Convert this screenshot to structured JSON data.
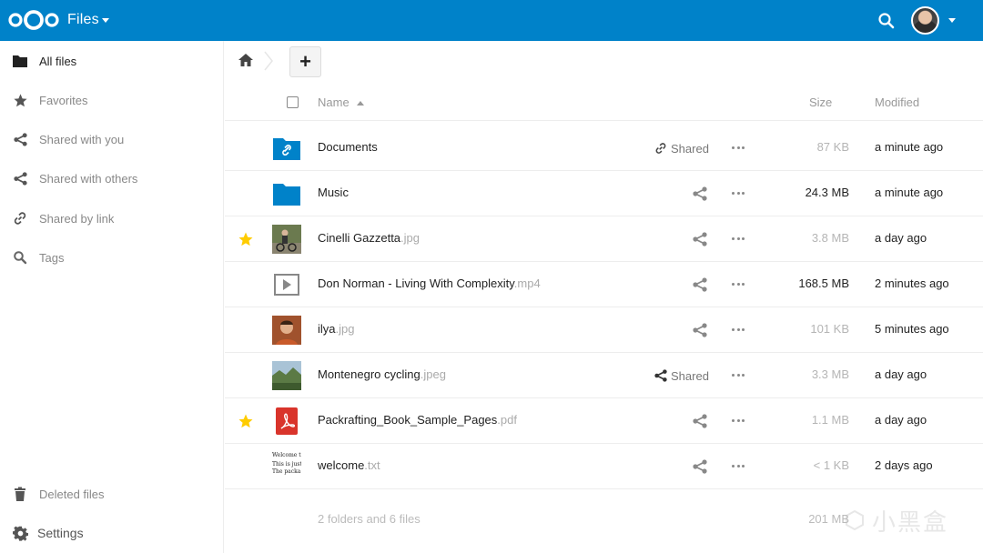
{
  "header": {
    "app_title": "Files",
    "logo_icon": "nextcloud-logo-icon",
    "search_icon": "search-icon",
    "brand_color": "#0082c9"
  },
  "sidebar": {
    "items": [
      {
        "label": "All files",
        "icon": "folder-icon",
        "active": true
      },
      {
        "label": "Favorites",
        "icon": "star-icon"
      },
      {
        "label": "Shared with you",
        "icon": "share-icon"
      },
      {
        "label": "Shared with others",
        "icon": "share-icon"
      },
      {
        "label": "Shared by link",
        "icon": "link-icon"
      },
      {
        "label": "Tags",
        "icon": "tag-search-icon"
      }
    ],
    "bottom": [
      {
        "label": "Deleted files",
        "icon": "trash-icon"
      },
      {
        "label": "Settings",
        "icon": "gear-icon"
      }
    ]
  },
  "breadcrumb": {
    "home_icon": "home-icon",
    "add_label": "+"
  },
  "table": {
    "headers": {
      "name": "Name",
      "size": "Size",
      "modified": "Modified"
    },
    "rows": [
      {
        "name": "Documents",
        "ext": "",
        "type": "folder-link",
        "favorite": false,
        "shared_label": "Shared",
        "share_kind": "link",
        "size": "87 KB",
        "modified": "a minute ago"
      },
      {
        "name": "Music",
        "ext": "",
        "type": "folder",
        "favorite": false,
        "shared_label": "",
        "share_kind": "none",
        "size": "24.3 MB",
        "modified": "a minute ago"
      },
      {
        "name": "Cinelli Gazzetta",
        "ext": ".jpg",
        "type": "image-bike",
        "favorite": true,
        "shared_label": "",
        "share_kind": "none",
        "size": "3.8 MB",
        "modified": "a day ago"
      },
      {
        "name": "Don Norman - Living With Complexity",
        "ext": ".mp4",
        "type": "video",
        "favorite": false,
        "shared_label": "",
        "share_kind": "none",
        "size": "168.5 MB",
        "modified": "2 minutes ago"
      },
      {
        "name": "ilya",
        "ext": ".jpg",
        "type": "image-person",
        "favorite": false,
        "shared_label": "",
        "share_kind": "none",
        "size": "101 KB",
        "modified": "5 minutes ago"
      },
      {
        "name": "Montenegro cycling",
        "ext": ".jpeg",
        "type": "image-landscape",
        "favorite": false,
        "shared_label": "Shared",
        "share_kind": "user",
        "size": "3.3 MB",
        "modified": "a day ago"
      },
      {
        "name": "Packrafting_Book_Sample_Pages",
        "ext": ".pdf",
        "type": "pdf",
        "favorite": true,
        "shared_label": "",
        "share_kind": "none",
        "size": "1.1 MB",
        "modified": "a day ago"
      },
      {
        "name": "welcome",
        "ext": ".txt",
        "type": "text",
        "favorite": false,
        "shared_label": "",
        "share_kind": "none",
        "size": "< 1 KB",
        "modified": "2 days ago"
      }
    ],
    "summary": {
      "count": "2 folders and 6 files",
      "total_size": "201 MB"
    }
  },
  "text_thumb": {
    "line1": "Welcome t",
    "line2": "This is just",
    "line3": "The packa"
  },
  "watermark": {
    "text": "小黑盒"
  },
  "colors": {
    "folder": "#0082c9",
    "star": "#fc0",
    "pdf": "#d9342b"
  }
}
